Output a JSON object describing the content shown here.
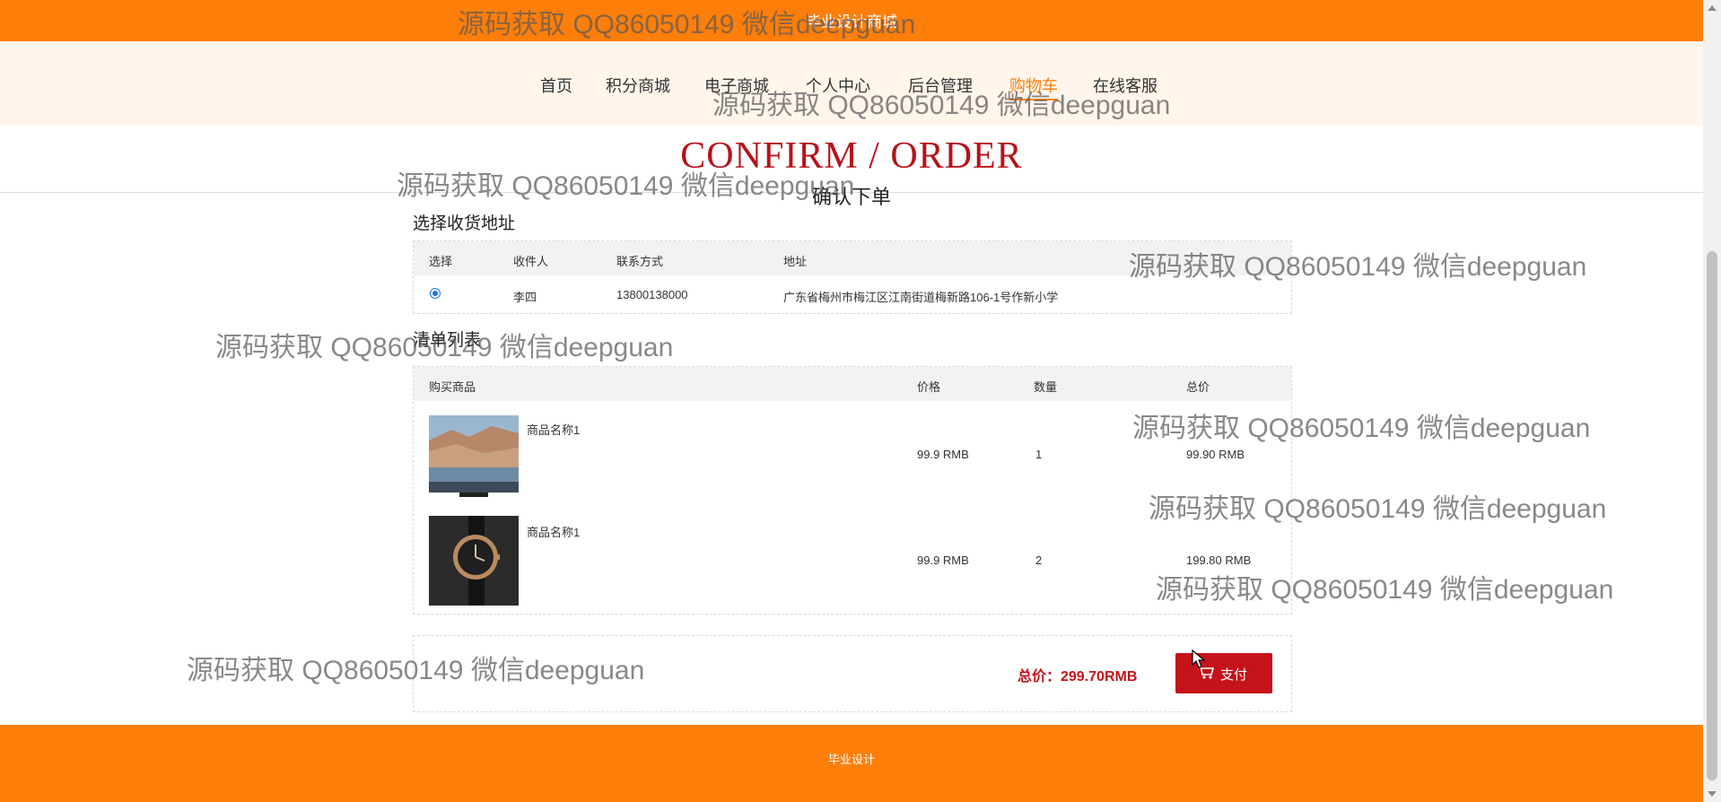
{
  "header": {
    "site_title": "毕业设计商城"
  },
  "nav": {
    "items": [
      {
        "label": "首页"
      },
      {
        "label": "积分商城"
      },
      {
        "label": "电子商城"
      },
      {
        "label": "个人中心"
      },
      {
        "label": "后台管理"
      },
      {
        "label": "购物车",
        "active": true
      },
      {
        "label": "在线客服"
      }
    ]
  },
  "hero": {
    "title": "CONFIRM / ORDER",
    "subtitle": "确认下单"
  },
  "address_section": {
    "label": "选择收货地址",
    "columns": [
      "选择",
      "收件人",
      "联系方式",
      "地址"
    ],
    "rows": [
      {
        "selected": true,
        "recipient": "李四",
        "phone": "13800138000",
        "address": "广东省梅州市梅江区江南街道梅新路106-1号作新小学"
      }
    ]
  },
  "items_section": {
    "label": "清单列表",
    "columns": [
      "购买商品",
      "价格",
      "数量",
      "总价"
    ],
    "rows": [
      {
        "name": "商品名称1",
        "image": "tv-image",
        "price": "99.9 RMB",
        "qty": "1",
        "subtotal": "99.90 RMB"
      },
      {
        "name": "商品名称1",
        "image": "watch-image",
        "price": "99.9 RMB",
        "qty": "2",
        "subtotal": "199.80 RMB"
      }
    ]
  },
  "checkout": {
    "total": "总价：299.70RMB",
    "pay_label": "支付",
    "pay_icon": "cart-icon"
  },
  "footer": {
    "text": "毕业设计"
  },
  "watermark": {
    "text": "源码获取 QQ86050149 微信deepguan"
  },
  "colors": {
    "brand": "#fe7e0a",
    "accent": "#c4131a",
    "nav_bg": "#fff5eb"
  }
}
